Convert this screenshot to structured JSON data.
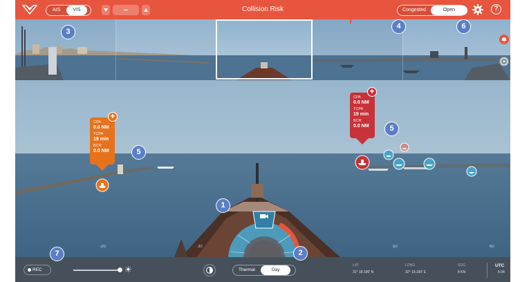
{
  "topbar": {
    "title": "Collision Risk",
    "source_toggle": {
      "options": [
        "AIS",
        "VIS"
      ],
      "selected": "VIS"
    },
    "traffic_toggle": {
      "options": [
        "Congested",
        "Open"
      ],
      "selected": "Open"
    },
    "help_label": "?"
  },
  "targets": [
    {
      "id": "target-orange",
      "color": "#e8721c",
      "cpa_label": "CPA",
      "cpa_value": "0.0 NM",
      "tcpa_label": "TCPA",
      "tcpa_value": "19 min",
      "bcr_label": "BCR",
      "bcr_value": "0.0 NM",
      "plus": "+"
    },
    {
      "id": "target-red",
      "color": "#c8323a",
      "cpa_label": "CPA",
      "cpa_value": "0.0 NM",
      "tcpa_label": "TCPA",
      "tcpa_value": "19 min",
      "bcr_label": "BCR",
      "bcr_value": "0.0 NM",
      "plus": "+"
    }
  ],
  "heading_ticks": [
    "-20",
    "30",
    "50",
    "60"
  ],
  "bottombar": {
    "rec_label": "REC",
    "thermal_toggle": {
      "options": [
        "Thermal",
        "Day"
      ],
      "selected": "Day"
    },
    "lat_label": "LAT",
    "lat_value": "31° 18.100' N",
    "long_label": "LONG",
    "long_value": "32° 19.190' E",
    "sog_label": "SOG",
    "sog_value": "8 KN",
    "utc_label": "UTC",
    "utc_value": "6:34"
  },
  "badges": [
    "1",
    "2",
    "3",
    "4",
    "5",
    "5",
    "6",
    "7"
  ],
  "colors": {
    "accent": "#e8553e",
    "badge": "#5b7fc6",
    "bottombar": "#45505a",
    "control_ring": "#4aa3c7"
  }
}
